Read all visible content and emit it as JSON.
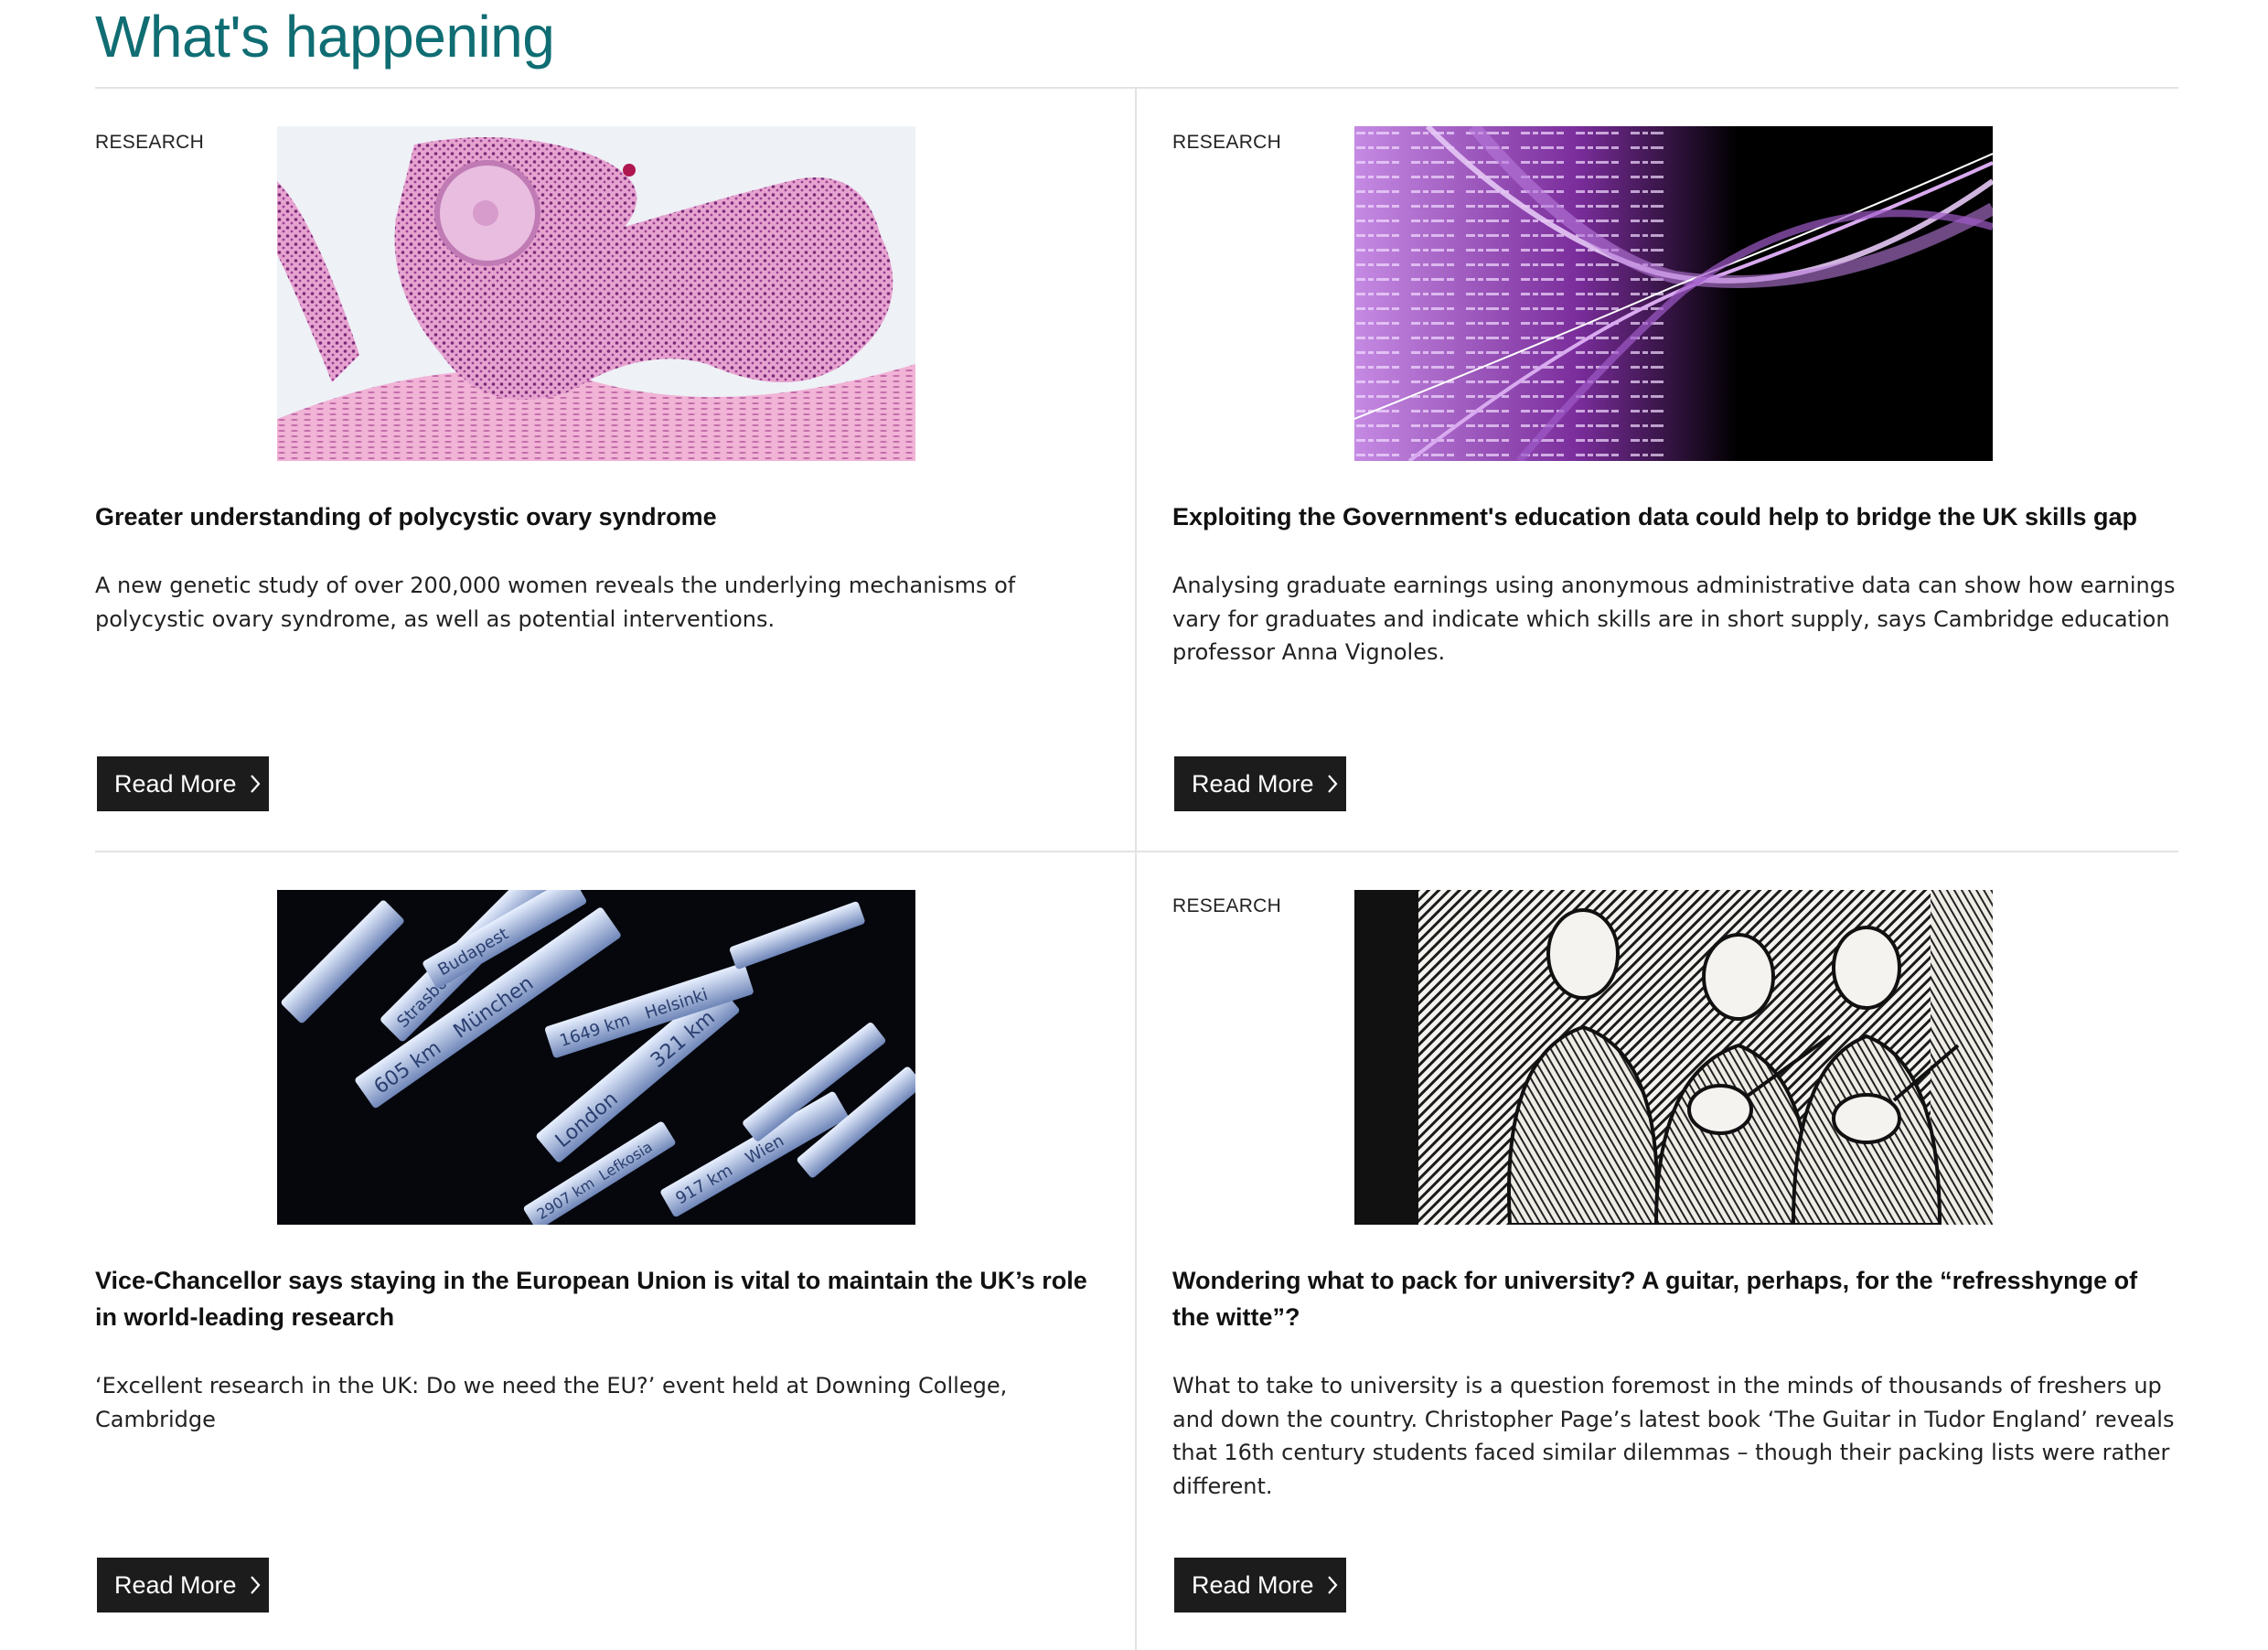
{
  "section": {
    "heading": "What's happening"
  },
  "cards": [
    {
      "tag": "RESEARCH",
      "title": "Greater understanding of polycystic ovary syndrome",
      "description": "A new genetic study of over 200,000 women reveals the underlying mechanisms of polycystic ovary syndrome, as well as potential interventions.",
      "button": "Read More",
      "image": "histology-tissue-image"
    },
    {
      "tag": "RESEARCH",
      "title": "Exploiting the Government's education data could help to bridge the UK skills gap",
      "description": "Analysing graduate earnings using anonymous administrative data can show how earnings vary for graduates and indicate which skills are in short supply, says Cambridge education professor Anna Vignoles.",
      "button": "Read More",
      "image": "data-streams-image"
    },
    {
      "tag": "",
      "title": "Vice-Chancellor says staying in the European Union is vital to maintain the UK’s role in world-leading research",
      "description": "‘Excellent research in the UK: Do we need the EU?’ event held at Downing College, Cambridge",
      "button": "Read More",
      "image": "european-signposts-image",
      "signs": [
        "605 km",
        "München",
        "London",
        "321 km",
        "1649 km",
        "Helsinki",
        "Strasbourg",
        "Budapest",
        "Wien",
        "917 km",
        "2907 km",
        "Lefkosia"
      ]
    },
    {
      "tag": "RESEARCH",
      "title": "Wondering what to pack for university? A guitar, perhaps, for the “refresshynge of the witte”?",
      "description": "What to take to university is a question foremost in the minds of thousands of freshers up and down the country. Christopher Page’s latest book ‘The Guitar in Tudor England’ reveals that 16th century students faced similar dilemmas – though their packing lists were rather different.",
      "button": "Read More",
      "image": "tudor-woodcut-image"
    }
  ],
  "colors": {
    "heading": "#0f6d73",
    "button": "#1c1c1c",
    "divider": "#e3e3e3"
  }
}
